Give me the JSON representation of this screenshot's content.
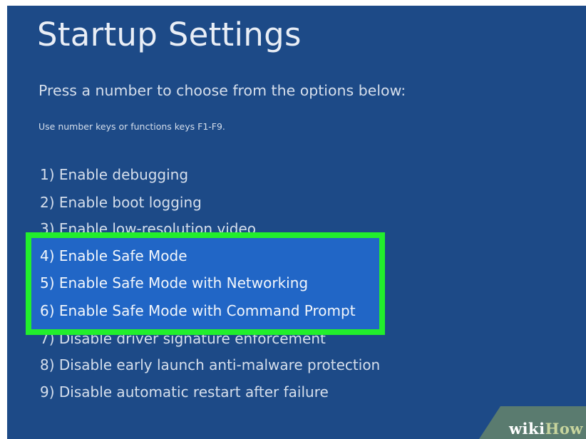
{
  "screen": {
    "title": "Startup Settings",
    "subtitle": "Press a number to choose from the options below:",
    "hint": "Use number keys or functions keys F1-F9."
  },
  "options": [
    {
      "label": "1) Enable debugging"
    },
    {
      "label": "2) Enable boot logging"
    },
    {
      "label": "3) Enable low-resolution video"
    },
    {
      "label": "4) Enable Safe Mode"
    },
    {
      "label": "5) Enable Safe Mode with Networking"
    },
    {
      "label": "6) Enable Safe Mode with Command Prompt"
    },
    {
      "label": "7) Disable driver signature enforcement"
    },
    {
      "label": "8) Disable early launch anti-malware protection"
    },
    {
      "label": "9) Disable automatic restart after failure"
    }
  ],
  "colors": {
    "background": "#1d4a87",
    "highlight_border": "#22ee2c",
    "highlight_fill": "#2166c6",
    "text": "#d6dfec"
  },
  "watermark": {
    "part1": "wiki",
    "part2": "How"
  }
}
